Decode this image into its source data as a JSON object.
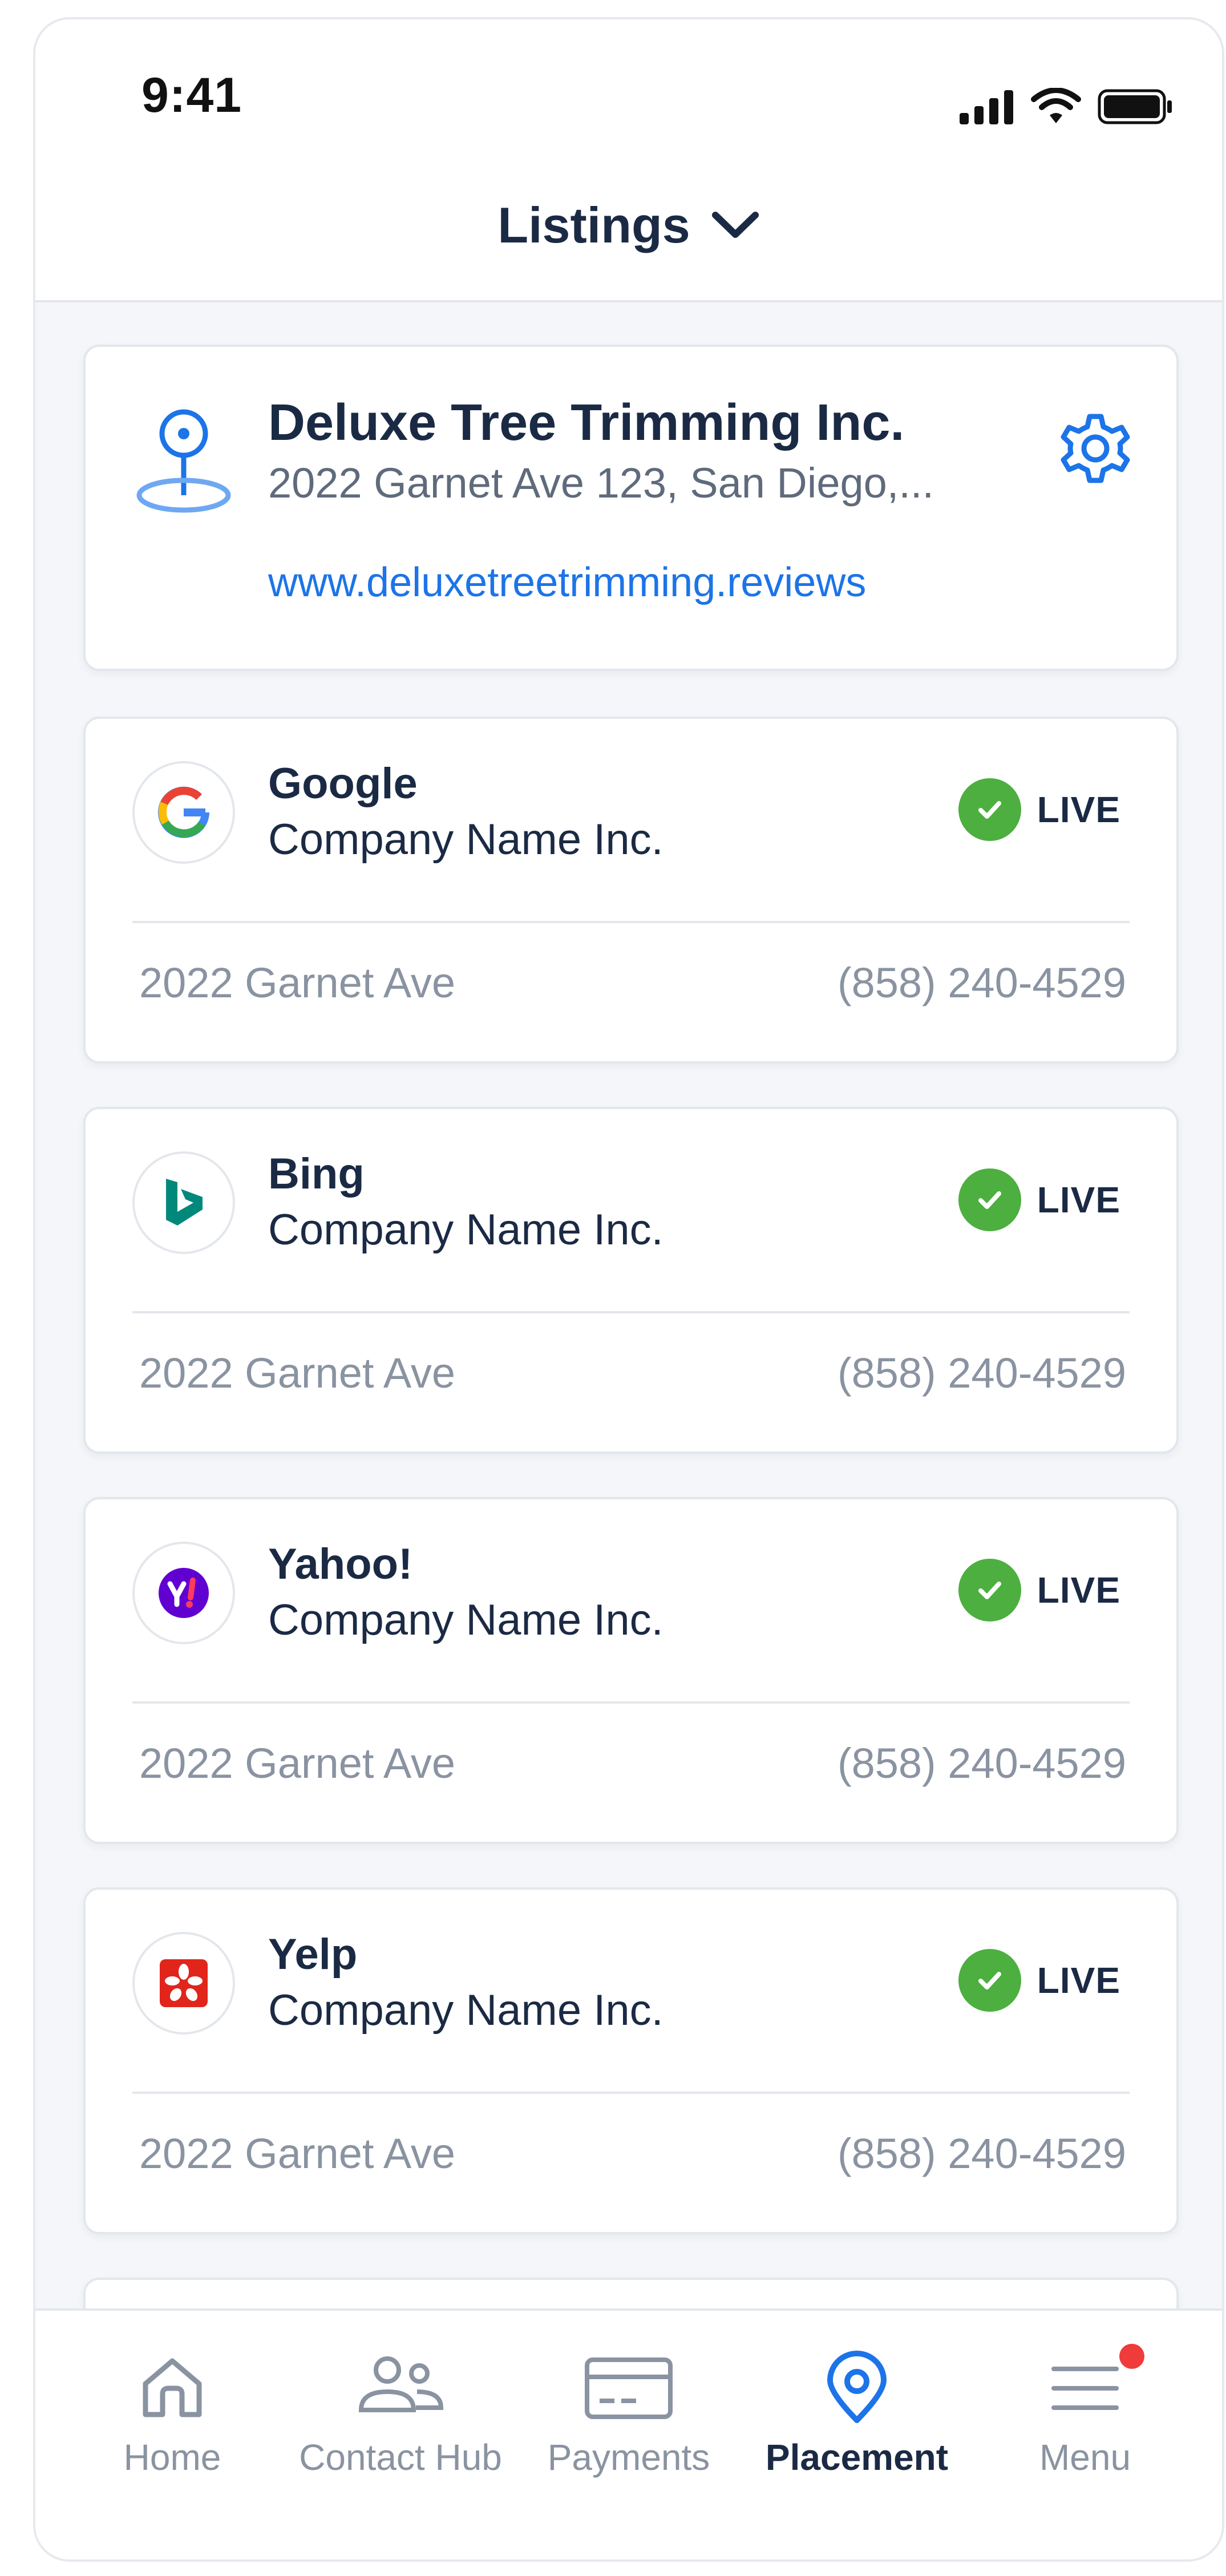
{
  "status_bar": {
    "time": "9:41"
  },
  "header": {
    "title": "Listings"
  },
  "business": {
    "name": "Deluxe Tree Trimming Inc.",
    "address": "2022 Garnet Ave 123, San Diego,...",
    "url": "www.deluxetreetrimming.reviews"
  },
  "listings": [
    {
      "directory": "Google",
      "company": "Company Name Inc.",
      "status": "LIVE",
      "address": "2022 Garnet Ave",
      "phone": "(858) 240-4529",
      "icon": "google-logo"
    },
    {
      "directory": "Bing",
      "company": "Company Name Inc.",
      "status": "LIVE",
      "address": "2022 Garnet Ave",
      "phone": "(858) 240-4529",
      "icon": "bing-logo"
    },
    {
      "directory": "Yahoo!",
      "company": "Company Name Inc.",
      "status": "LIVE",
      "address": "2022 Garnet Ave",
      "phone": "(858) 240-4529",
      "icon": "yahoo-logo"
    },
    {
      "directory": "Yelp",
      "company": "Company Name Inc.",
      "status": "LIVE",
      "address": "2022 Garnet Ave",
      "phone": "(858) 240-4529",
      "icon": "yelp-logo"
    }
  ],
  "bottom_nav": {
    "items": [
      {
        "label": "Home",
        "icon": "home-icon"
      },
      {
        "label": "Contact Hub",
        "icon": "people-icon"
      },
      {
        "label": "Payments",
        "icon": "card-icon"
      },
      {
        "label": "Placement",
        "icon": "location-pin-icon",
        "active": true
      },
      {
        "label": "Menu",
        "icon": "menu-icon",
        "badge": true
      }
    ]
  },
  "colors": {
    "accent": "#1c74e8",
    "live": "#4caf3f",
    "badge": "#ef3b3b",
    "text_dark": "#1b2a44",
    "text_muted": "#8a93a1"
  }
}
